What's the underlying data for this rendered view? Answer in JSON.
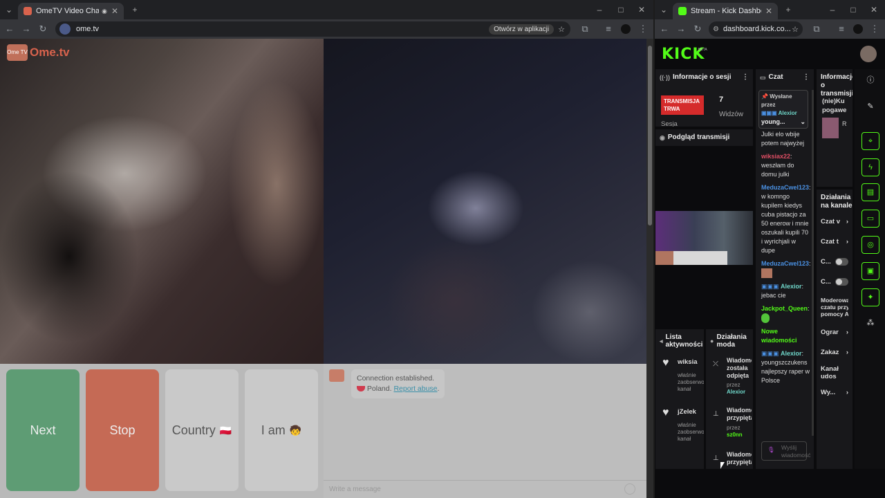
{
  "left_window": {
    "tab_title": "OmeTV Video Chat — Ome",
    "url": "ome.tv",
    "open_in_app": "Otwórz w aplikacji"
  },
  "ometv": {
    "logo_badge": "Ome TV",
    "logo_text": "Ome.tv",
    "buttons": {
      "next": "Next",
      "stop": "Stop",
      "country": "Country",
      "country_flag": "🇵🇱",
      "iam": "I am",
      "iam_emoji": "🧒"
    },
    "system_message": {
      "line1": "Connection established.",
      "country": "Poland.",
      "report": "Report abuse",
      "report_suffix": "."
    },
    "input_placeholder": "Write a message"
  },
  "right_window": {
    "tab_title": "Stream - Kick Dashboard",
    "url": "dashboard.kick.co..."
  },
  "kick": {
    "logo": "KICK",
    "beta": "BETA",
    "session": {
      "title": "Informacje o sesji",
      "live_badge": "TRANSMISJA TRWA",
      "viewers": "7",
      "viewers_label": "Widzów",
      "session_label": "Sesja"
    },
    "preview_title": "Podgląd transmisji",
    "chat": {
      "title": "Czat",
      "pinned_label": "Wysłane przez",
      "pinned_user": "Alexior",
      "pinned_preview": "young...",
      "messages": [
        {
          "user": "",
          "text": "Julki elo wbije potem najwyżej",
          "color": "#ddd"
        },
        {
          "user": "wiksiax22",
          "text": ": weszłam do domu julki",
          "color": "#e04e64"
        },
        {
          "user": "MeduzaCwel123",
          "text": ": w komngo kupilem kiedys cuba pistacjo za 50 enerow i mnie oszukali kupili 70 i wyrichjali w dupe",
          "color": "#4a90e2"
        },
        {
          "user": "MeduzaCwel123",
          "text": ":",
          "color": "#4a90e2"
        },
        {
          "user": "Alexior",
          "text": ": jebac cie",
          "color": "#6fd6c9"
        },
        {
          "user": "Jackpot_Queen",
          "text": ":",
          "color": "#53fc18"
        },
        {
          "user": "Alexior",
          "text": ": youngszczukens najlepszy raper w Polsce",
          "color": "#6fd6c9"
        }
      ],
      "new_messages": "Nowe wiadomości",
      "send_placeholder": "Wyślij wiadomość"
    },
    "stream_info": {
      "title": "Informacje o transmisji",
      "line1": "(nie)Ku",
      "line2": "pogawe",
      "tag": "R"
    },
    "activity": {
      "title": "Lista aktywności",
      "items": [
        {
          "user": "wiksia",
          "sub": "właśnie zaobserwował kanał"
        },
        {
          "user": "jZelek",
          "sub": "właśnie zaobserwował kanał"
        }
      ]
    },
    "mod_actions": {
      "title": "Działania moda",
      "items": [
        {
          "action": "Wiadomość została odpięta",
          "by": "przez",
          "user": "Alexior"
        },
        {
          "action": "Wiadomość przypięta",
          "by": "przez",
          "user": "sz0nn"
        },
        {
          "action": "Wiadomość przypięta",
          "by": "",
          "user": ""
        }
      ]
    },
    "channel_actions": {
      "title": "Działania na kanale",
      "rows": [
        "Czat v",
        "Czat t",
        "C...",
        "C...",
        "Moderowanie czatu przy pomocy AI",
        "Ograr",
        "Zakaz",
        "Kanał udos",
        "Wy..."
      ]
    },
    "sidebar_icons": [
      "info-icon",
      "pencil-icon",
      "target-icon",
      "bolt-icon",
      "document-icon",
      "chat-icon",
      "broadcast-icon",
      "id-card-icon",
      "wrench-icon",
      "apps-icon"
    ]
  }
}
